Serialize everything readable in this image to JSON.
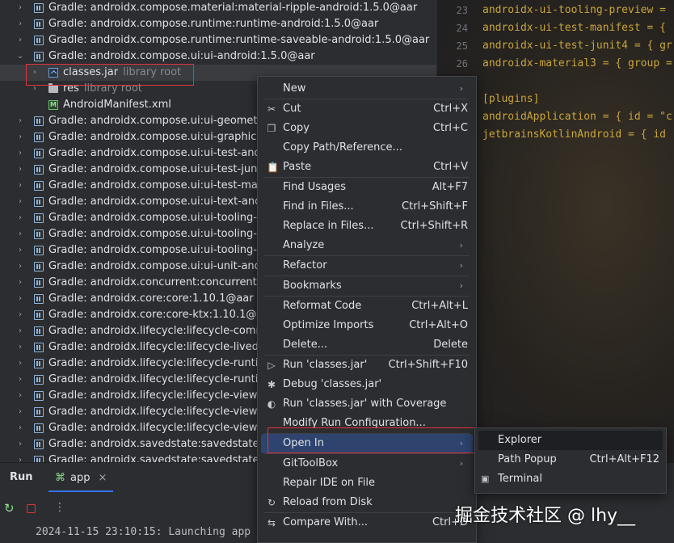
{
  "tree": {
    "rows": [
      {
        "level": 0,
        "chevron": "›",
        "icon": "library",
        "label": "Gradle: androidx.compose.material:material-ripple-android:1.5.0@aar",
        "hint": ""
      },
      {
        "level": 0,
        "chevron": "›",
        "icon": "library",
        "label": "Gradle: androidx.compose.runtime:runtime-android:1.5.0@aar",
        "hint": ""
      },
      {
        "level": 0,
        "chevron": "›",
        "icon": "library",
        "label": "Gradle: androidx.compose.runtime:runtime-saveable-android:1.5.0@aar",
        "hint": ""
      },
      {
        "level": 0,
        "chevron": "⌄",
        "icon": "library",
        "label": "Gradle: androidx.compose.ui:ui-android:1.5.0@aar",
        "hint": ""
      },
      {
        "level": 1,
        "chevron": "›",
        "icon": "jar",
        "label": "classes.jar",
        "hint": "library root"
      },
      {
        "level": 1,
        "chevron": "›",
        "icon": "folder",
        "label": "res",
        "hint": "library root"
      },
      {
        "level": 1,
        "chevron": "",
        "icon": "manifest",
        "label": "AndroidManifest.xml",
        "hint": ""
      },
      {
        "level": 0,
        "chevron": "›",
        "icon": "library",
        "label": "Gradle: androidx.compose.ui:ui-geometry",
        "hint": ""
      },
      {
        "level": 0,
        "chevron": "›",
        "icon": "library",
        "label": "Gradle: androidx.compose.ui:ui-graphics-",
        "hint": ""
      },
      {
        "level": 0,
        "chevron": "›",
        "icon": "library",
        "label": "Gradle: androidx.compose.ui:ui-test-andr",
        "hint": ""
      },
      {
        "level": 0,
        "chevron": "›",
        "icon": "library",
        "label": "Gradle: androidx.compose.ui:ui-test-junit",
        "hint": ""
      },
      {
        "level": 0,
        "chevron": "›",
        "icon": "library",
        "label": "Gradle: androidx.compose.ui:ui-test-man",
        "hint": ""
      },
      {
        "level": 0,
        "chevron": "›",
        "icon": "library",
        "label": "Gradle: androidx.compose.ui:ui-text-andr",
        "hint": ""
      },
      {
        "level": 0,
        "chevron": "›",
        "icon": "library",
        "label": "Gradle: androidx.compose.ui:ui-tooling-a",
        "hint": ""
      },
      {
        "level": 0,
        "chevron": "›",
        "icon": "library",
        "label": "Gradle: androidx.compose.ui:ui-tooling-d",
        "hint": ""
      },
      {
        "level": 0,
        "chevron": "›",
        "icon": "library",
        "label": "Gradle: androidx.compose.ui:ui-tooling-p",
        "hint": ""
      },
      {
        "level": 0,
        "chevron": "›",
        "icon": "library",
        "label": "Gradle: androidx.compose.ui:ui-unit-andr",
        "hint": ""
      },
      {
        "level": 0,
        "chevron": "›",
        "icon": "library",
        "label": "Gradle: androidx.concurrent:concurrent-f",
        "hint": ""
      },
      {
        "level": 0,
        "chevron": "›",
        "icon": "library",
        "label": "Gradle: androidx.core:core:1.10.1@aar",
        "hint": ""
      },
      {
        "level": 0,
        "chevron": "›",
        "icon": "library",
        "label": "Gradle: androidx.core:core-ktx:1.10.1@aa",
        "hint": ""
      },
      {
        "level": 0,
        "chevron": "›",
        "icon": "library",
        "label": "Gradle: androidx.lifecycle:lifecycle-comm",
        "hint": ""
      },
      {
        "level": 0,
        "chevron": "›",
        "icon": "library",
        "label": "Gradle: androidx.lifecycle:lifecycle-livedat",
        "hint": ""
      },
      {
        "level": 0,
        "chevron": "›",
        "icon": "library",
        "label": "Gradle: androidx.lifecycle:lifecycle-runtim",
        "hint": ""
      },
      {
        "level": 0,
        "chevron": "›",
        "icon": "library",
        "label": "Gradle: androidx.lifecycle:lifecycle-runtim",
        "hint": ""
      },
      {
        "level": 0,
        "chevron": "›",
        "icon": "library",
        "label": "Gradle: androidx.lifecycle:lifecycle-viewm",
        "hint": ""
      },
      {
        "level": 0,
        "chevron": "›",
        "icon": "library",
        "label": "Gradle: androidx.lifecycle:lifecycle-viewm",
        "hint": ""
      },
      {
        "level": 0,
        "chevron": "›",
        "icon": "library",
        "label": "Gradle: androidx.lifecycle:lifecycle-viewm",
        "hint": ""
      },
      {
        "level": 0,
        "chevron": "›",
        "icon": "library",
        "label": "Gradle: androidx.savedstate:savedstate:1",
        "hint": ""
      },
      {
        "level": 0,
        "chevron": "›",
        "icon": "library",
        "label": "Gradle: androidx.savedstate:savedstate-",
        "hint": ""
      }
    ]
  },
  "editor": {
    "lines": [
      {
        "num": "23",
        "text": "androidx-ui-tooling-preview = "
      },
      {
        "num": "24",
        "text": "androidx-ui-test-manifest = { "
      },
      {
        "num": "25",
        "text": "androidx-ui-test-junit4 = { gr"
      },
      {
        "num": "26",
        "text": "androidx-material3 = { group ="
      },
      {
        "num": "",
        "text": ""
      },
      {
        "num": "",
        "text": "[plugins]"
      },
      {
        "num": "",
        "text": "androidApplication = { id = \"c"
      },
      {
        "num": "",
        "text": "jetbrainsKotlinAndroid = { id "
      }
    ]
  },
  "bottom": {
    "run_title": "Run",
    "tab_label": "app",
    "tab_close": "×",
    "log_line": "2024-11-15 23:10:15: Launching app on 'Medium Phone API 36'."
  },
  "context_menu": {
    "items": [
      {
        "label": "New",
        "shortcut": "",
        "submenu": true,
        "icon": ""
      },
      {
        "sep": true
      },
      {
        "label": "Cut",
        "shortcut": "Ctrl+X",
        "submenu": false,
        "icon": "cut-icon",
        "glyph": "✂"
      },
      {
        "label": "Copy",
        "shortcut": "Ctrl+C",
        "submenu": false,
        "icon": "copy-icon",
        "glyph": "❐"
      },
      {
        "label": "Copy Path/Reference...",
        "shortcut": "",
        "submenu": false,
        "icon": ""
      },
      {
        "label": "Paste",
        "shortcut": "Ctrl+V",
        "submenu": false,
        "icon": "paste-icon",
        "glyph": "📋"
      },
      {
        "sep": true
      },
      {
        "label": "Find Usages",
        "shortcut": "Alt+F7",
        "submenu": false,
        "icon": ""
      },
      {
        "label": "Find in Files...",
        "shortcut": "Ctrl+Shift+F",
        "submenu": false,
        "icon": ""
      },
      {
        "label": "Replace in Files...",
        "shortcut": "Ctrl+Shift+R",
        "submenu": false,
        "icon": ""
      },
      {
        "label": "Analyze",
        "shortcut": "",
        "submenu": true,
        "icon": ""
      },
      {
        "sep": true
      },
      {
        "label": "Refactor",
        "shortcut": "",
        "submenu": true,
        "icon": ""
      },
      {
        "sep": true
      },
      {
        "label": "Bookmarks",
        "shortcut": "",
        "submenu": true,
        "icon": ""
      },
      {
        "sep": true
      },
      {
        "label": "Reformat Code",
        "shortcut": "Ctrl+Alt+L",
        "submenu": false,
        "icon": ""
      },
      {
        "label": "Optimize Imports",
        "shortcut": "Ctrl+Alt+O",
        "submenu": false,
        "icon": ""
      },
      {
        "label": "Delete...",
        "shortcut": "Delete",
        "submenu": false,
        "icon": ""
      },
      {
        "sep": true
      },
      {
        "label": "Run 'classes.jar'",
        "shortcut": "Ctrl+Shift+F10",
        "submenu": false,
        "icon": "run-icon",
        "glyph": "▷"
      },
      {
        "label": "Debug 'classes.jar'",
        "shortcut": "",
        "submenu": false,
        "icon": "debug-icon",
        "glyph": "✱"
      },
      {
        "label": "Run 'classes.jar' with Coverage",
        "shortcut": "",
        "submenu": false,
        "icon": "coverage-icon",
        "glyph": "◐"
      },
      {
        "label": "Modify Run Configuration...",
        "shortcut": "",
        "submenu": false,
        "icon": ""
      },
      {
        "sep": true
      },
      {
        "label": "Open In",
        "shortcut": "",
        "submenu": true,
        "icon": "",
        "selected": true
      },
      {
        "sep": true
      },
      {
        "label": "GitToolBox",
        "shortcut": "",
        "submenu": true,
        "icon": ""
      },
      {
        "label": "Repair IDE on File",
        "shortcut": "",
        "submenu": false,
        "icon": ""
      },
      {
        "label": "Reload from Disk",
        "shortcut": "",
        "submenu": false,
        "icon": "reload-icon",
        "glyph": "↻"
      },
      {
        "sep": true
      },
      {
        "label": "Compare With...",
        "shortcut": "Ctrl+D",
        "submenu": false,
        "icon": "compare-icon",
        "glyph": "⇆"
      }
    ]
  },
  "submenu": {
    "items": [
      {
        "label": "Explorer",
        "shortcut": "",
        "icon": "",
        "selected": true
      },
      {
        "label": "Path Popup",
        "shortcut": "Ctrl+Alt+F12",
        "icon": ""
      },
      {
        "label": "Terminal",
        "shortcut": "",
        "icon": "terminal-icon",
        "glyph": "▣"
      }
    ]
  },
  "watermark": "掘金技术社区 @ lhy__",
  "colors": {
    "selection": "#2e436e",
    "highlight_box": "#e0343b",
    "accent": "#3574f0"
  }
}
